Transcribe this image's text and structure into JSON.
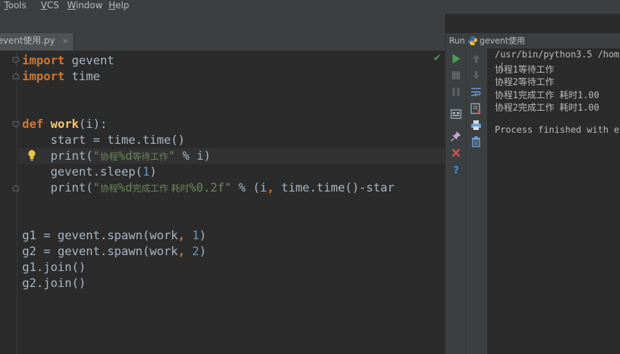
{
  "menu": {
    "tools_mnemonic": "T",
    "tools_rest": "ools",
    "vcs_mnemonic": "V",
    "vcs_rest": "CS",
    "window_mnemonic": "W",
    "window_rest": "indow",
    "help_mnemonic": "H",
    "help_rest": "elp"
  },
  "editor": {
    "tab_label": "gevent使用.py",
    "tab_close": "×",
    "lines": [
      {
        "tokens": [
          {
            "t": "import",
            "c": "kw"
          },
          {
            "t": " gevent",
            "c": ""
          }
        ]
      },
      {
        "tokens": [
          {
            "t": "import",
            "c": "kw"
          },
          {
            "t": " time",
            "c": ""
          }
        ]
      },
      {
        "tokens": []
      },
      {
        "tokens": []
      },
      {
        "tokens": [
          {
            "t": "def",
            "c": "kw"
          },
          {
            "t": " ",
            "c": ""
          },
          {
            "t": "work",
            "c": "fn"
          },
          {
            "t": "(i):",
            "c": ""
          }
        ]
      },
      {
        "tokens": [
          {
            "t": "    start = time.time()",
            "c": ""
          }
        ]
      },
      {
        "tokens": [
          {
            "t": "    print(",
            "c": ""
          },
          {
            "t": "\"",
            "c": "str"
          },
          {
            "t": "协程",
            "c": "cjk"
          },
          {
            "t": "%d",
            "c": "str"
          },
          {
            "t": "等待工作",
            "c": "cjk"
          },
          {
            "t": "\"",
            "c": "str"
          },
          {
            "t": " % i)",
            "c": ""
          }
        ]
      },
      {
        "tokens": [
          {
            "t": "    gevent.sleep(",
            "c": ""
          },
          {
            "t": "1",
            "c": "num"
          },
          {
            "t": ")",
            "c": ""
          }
        ]
      },
      {
        "tokens": [
          {
            "t": "    print(",
            "c": ""
          },
          {
            "t": "\"",
            "c": "str"
          },
          {
            "t": "协程",
            "c": "cjk"
          },
          {
            "t": "%d",
            "c": "str"
          },
          {
            "t": "完成工作 耗时",
            "c": "cjk"
          },
          {
            "t": "%0.2f\"",
            "c": "str"
          },
          {
            "t": " % (i",
            "c": ""
          },
          {
            "t": ",",
            "c": "kw"
          },
          {
            "t": " time.time()-star",
            "c": ""
          }
        ]
      },
      {
        "tokens": []
      },
      {
        "tokens": []
      },
      {
        "tokens": [
          {
            "t": "g1 = gevent.spawn(work",
            "c": ""
          },
          {
            "t": ",",
            "c": "kw"
          },
          {
            "t": " ",
            "c": ""
          },
          {
            "t": "1",
            "c": "num"
          },
          {
            "t": ")",
            "c": ""
          }
        ]
      },
      {
        "tokens": [
          {
            "t": "g2 = gevent.spawn(work",
            "c": ""
          },
          {
            "t": ",",
            "c": "kw"
          },
          {
            "t": " ",
            "c": ""
          },
          {
            "t": "2",
            "c": "num"
          },
          {
            "t": ")",
            "c": ""
          }
        ]
      },
      {
        "tokens": [
          {
            "t": "g1.join()",
            "c": ""
          }
        ]
      },
      {
        "tokens": [
          {
            "t": "g2.join()",
            "c": ""
          }
        ]
      }
    ]
  },
  "run": {
    "title": "Run",
    "config_name": "gevent使用",
    "output": [
      "/usr/bin/python3.5 /hom",
      "协程1等待工作",
      "协程2等待工作",
      "协程1完成工作 耗时1.00",
      "协程2完成工作 耗时1.00",
      "",
      "Process finished with e"
    ]
  },
  "colors": {
    "keyword": "#cc7832",
    "function": "#ffc66d",
    "string": "#6a8759",
    "number": "#6897bb",
    "text": "#a9b7c6",
    "background": "#2b2b2b",
    "chrome": "#3c3f41"
  }
}
